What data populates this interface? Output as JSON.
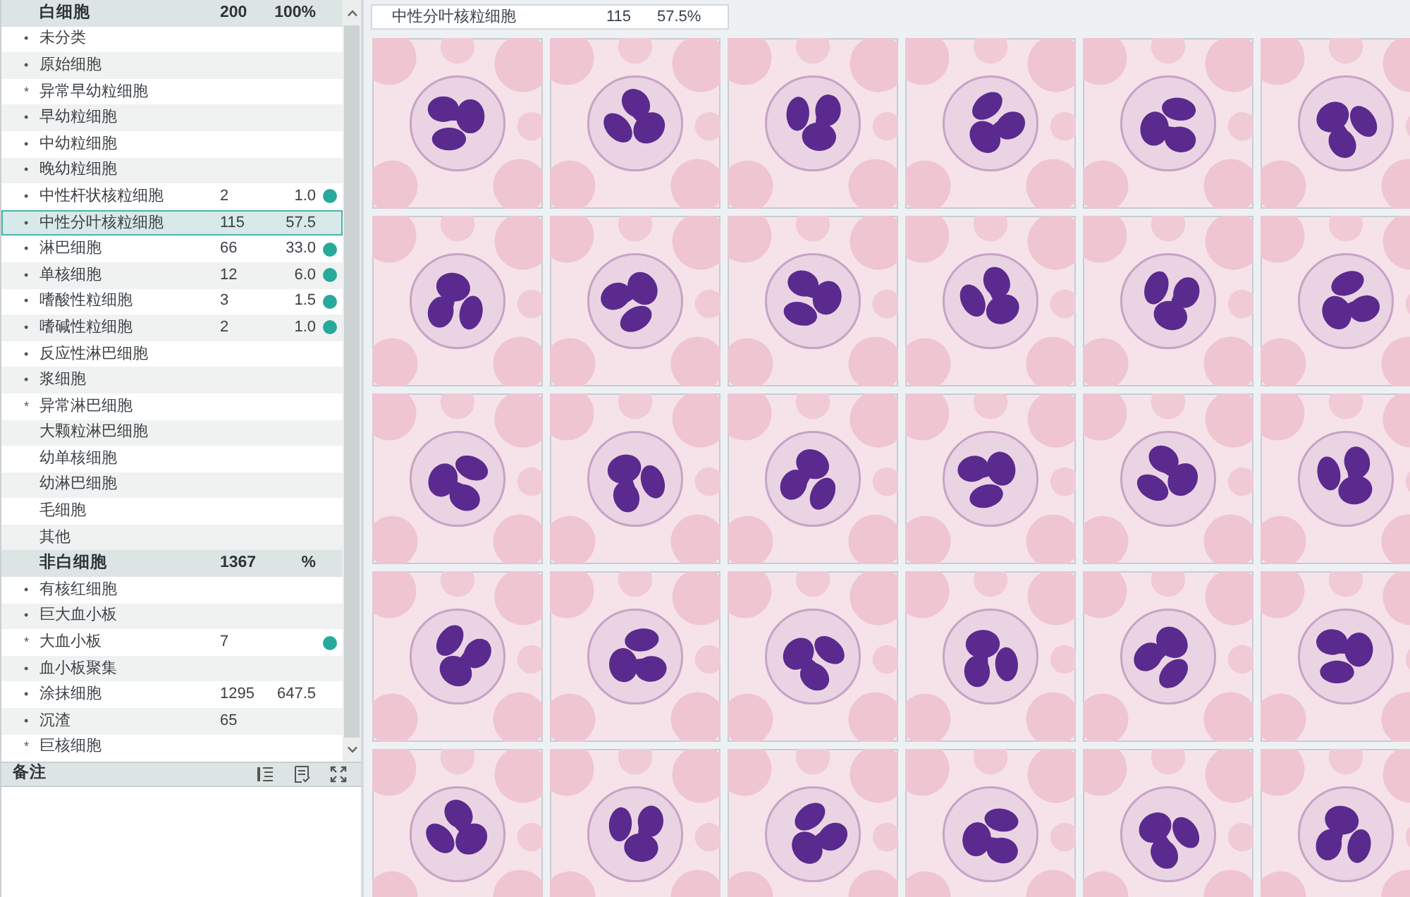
{
  "cell_list": {
    "sections": [
      {
        "label": "白细胞",
        "count": "200",
        "percent": "100%",
        "items": [
          {
            "marker": "•",
            "name": "未分类",
            "selected": false,
            "marked": false
          },
          {
            "marker": "•",
            "name": "原始细胞",
            "selected": false,
            "marked": false
          },
          {
            "marker": "*",
            "name": "异常早幼粒细胞",
            "selected": false,
            "marked": false
          },
          {
            "marker": "•",
            "name": "早幼粒细胞",
            "selected": false,
            "marked": false
          },
          {
            "marker": "•",
            "name": "中幼粒细胞",
            "selected": false,
            "marked": false
          },
          {
            "marker": "•",
            "name": "晚幼粒细胞",
            "selected": false,
            "marked": false
          },
          {
            "marker": "•",
            "name": "中性杆状核粒细胞",
            "count": "2",
            "percent": "1.0",
            "selected": false,
            "marked": true
          },
          {
            "marker": "•",
            "name": "中性分叶核粒细胞",
            "count": "115",
            "percent": "57.5",
            "selected": true,
            "marked": false
          },
          {
            "marker": "•",
            "name": "淋巴细胞",
            "count": "66",
            "percent": "33.0",
            "selected": false,
            "marked": true
          },
          {
            "marker": "•",
            "name": "单核细胞",
            "count": "12",
            "percent": "6.0",
            "selected": false,
            "marked": true
          },
          {
            "marker": "•",
            "name": "嗜酸性粒细胞",
            "count": "3",
            "percent": "1.5",
            "selected": false,
            "marked": true
          },
          {
            "marker": "•",
            "name": "嗜碱性粒细胞",
            "count": "2",
            "percent": "1.0",
            "selected": false,
            "marked": true
          },
          {
            "marker": "•",
            "name": "反应性淋巴细胞",
            "selected": false,
            "marked": false
          },
          {
            "marker": "•",
            "name": "浆细胞",
            "selected": false,
            "marked": false
          },
          {
            "marker": "*",
            "name": "异常淋巴细胞",
            "selected": false,
            "marked": false
          },
          {
            "name": "大颗粒淋巴细胞",
            "selected": false,
            "marked": false
          },
          {
            "name": "幼单核细胞",
            "selected": false,
            "marked": false
          },
          {
            "name": "幼淋巴细胞",
            "selected": false,
            "marked": false
          },
          {
            "name": "毛细胞",
            "selected": false,
            "marked": false
          },
          {
            "name": "其他",
            "selected": false,
            "marked": false
          }
        ]
      },
      {
        "label": "非白细胞",
        "count": "1367",
        "percent": "%",
        "items": [
          {
            "marker": "•",
            "name": "有核红细胞",
            "selected": false,
            "marked": false
          },
          {
            "marker": "•",
            "name": "巨大血小板",
            "selected": false,
            "marked": false
          },
          {
            "marker": "*",
            "name": "大血小板",
            "count": "7",
            "selected": false,
            "marked": true
          },
          {
            "marker": "•",
            "name": "血小板聚集",
            "selected": false,
            "marked": false
          },
          {
            "marker": "•",
            "name": "涂抹细胞",
            "count": "1295",
            "percent": "647.5",
            "selected": false,
            "marked": false
          },
          {
            "marker": "•",
            "name": "沉渣",
            "count": "65",
            "selected": false,
            "marked": false
          },
          {
            "marker": "*",
            "name": "巨核细胞",
            "selected": false,
            "marked": false
          }
        ]
      }
    ]
  },
  "notes": {
    "title": "备注"
  },
  "summary": {
    "name": "中性分叶核粒细胞",
    "count": "115",
    "percent": "57.5%"
  }
}
